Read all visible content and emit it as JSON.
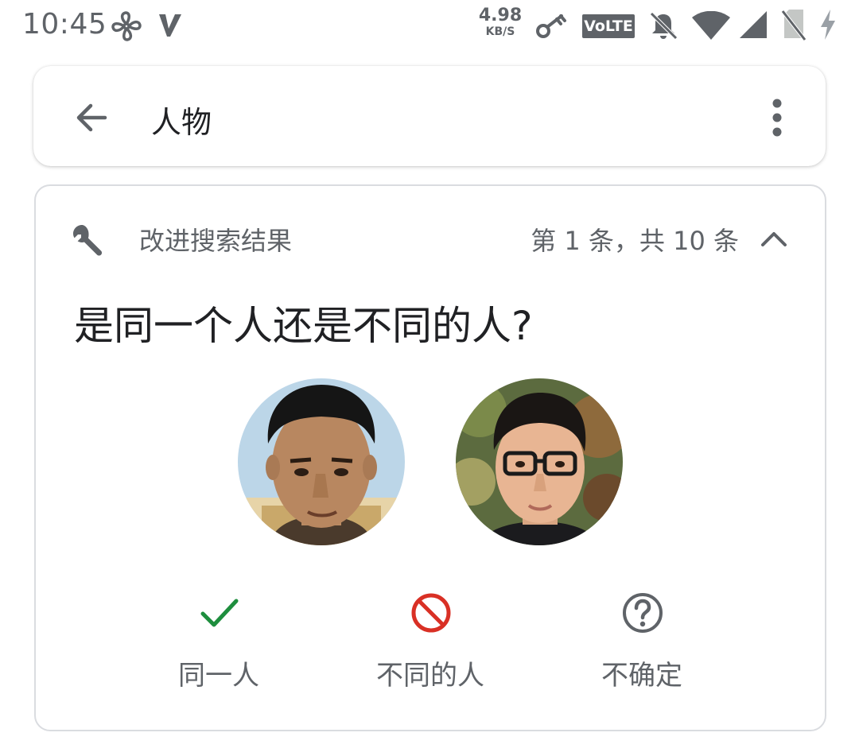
{
  "status_bar": {
    "time": "10:45",
    "net_speed_value": "4.98",
    "net_speed_unit": "KB/S",
    "volte_label": "VoLTE",
    "icons": [
      "fan-icon",
      "v-app-icon",
      "vpn-key-icon",
      "volte-icon",
      "mute-icon",
      "wifi-icon",
      "signal-icon",
      "no-sim-icon",
      "charging-icon"
    ]
  },
  "app_bar": {
    "title": "人物",
    "back_icon": "arrow-back-icon",
    "more_icon": "more-vert-icon"
  },
  "card": {
    "header_label": "改进搜索结果",
    "counter": "第 1 条，共 10 条",
    "question": "是同一个人还是不同的人?",
    "choices": [
      {
        "label": "同一人",
        "icon": "check-icon",
        "color": "#1e8e3e"
      },
      {
        "label": "不同的人",
        "icon": "block-icon",
        "color": "#d93025"
      },
      {
        "label": "不确定",
        "icon": "help-circle-icon",
        "color": "#5f6368"
      }
    ]
  },
  "colors": {
    "text_primary": "#202124",
    "text_secondary": "#5f6368",
    "card_border": "#dadce0"
  }
}
